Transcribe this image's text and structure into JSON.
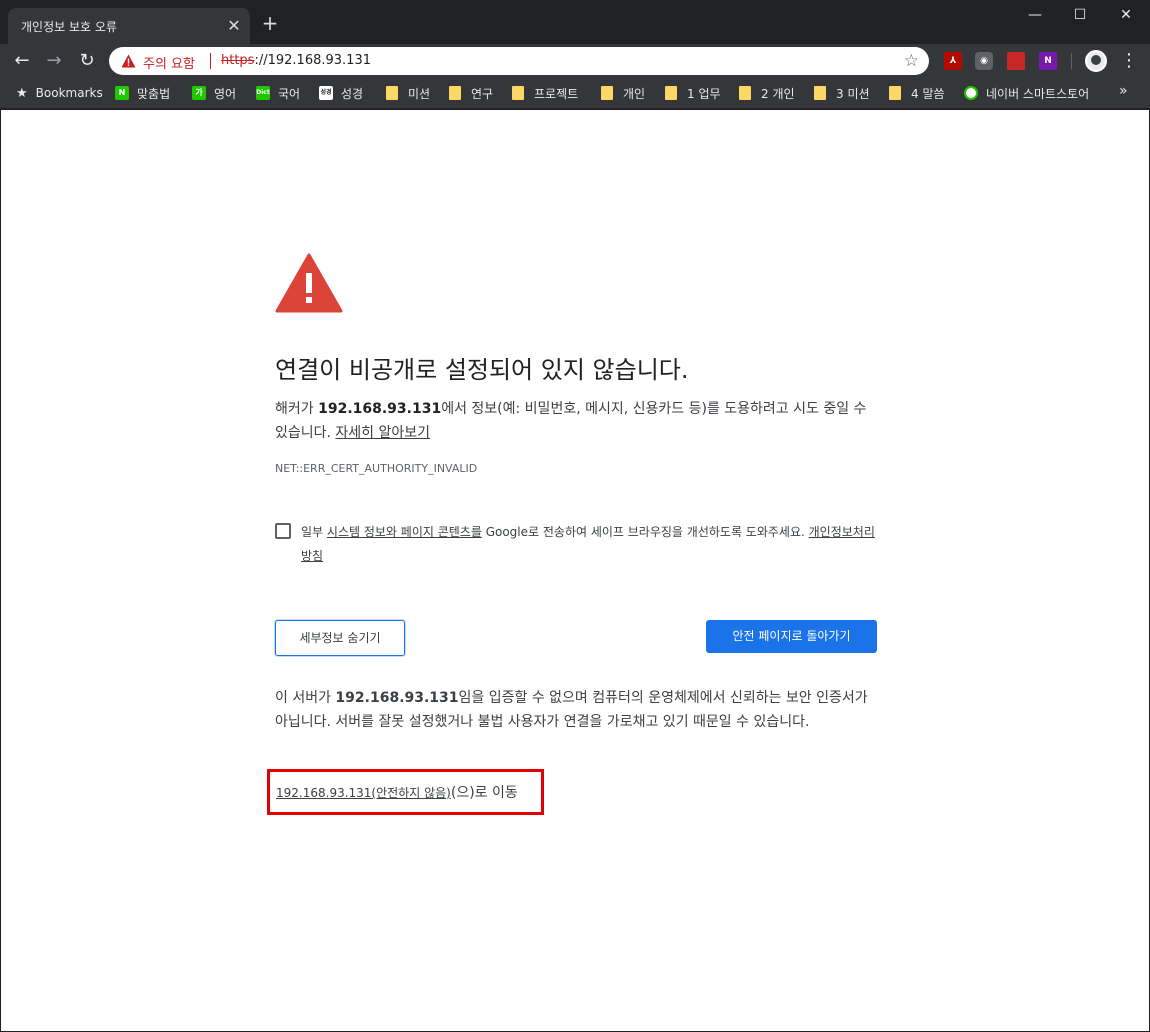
{
  "tab": {
    "title": "개인정보 보호 오류",
    "close": "✕",
    "new": "+"
  },
  "window": {
    "minimize": "—",
    "maximize": "☐",
    "close": "✕"
  },
  "toolbar": {
    "back": "←",
    "forward": "→",
    "reload": "↻",
    "security_label": "주의 요함",
    "url_scheme": "https",
    "url_host": "://192.168.93.131",
    "star": "☆",
    "menu": "⋮"
  },
  "bookmarks": {
    "items": [
      {
        "label": "Bookmarks",
        "icon": "star-icon"
      },
      {
        "label": "맞춤법",
        "icon": "naver-icon",
        "badge": "N",
        "color": "#1ec800"
      },
      {
        "label": "영어",
        "icon": "dict-icon",
        "badge": "가",
        "color": "#1ec800"
      },
      {
        "label": "국어",
        "icon": "dict-icon",
        "badge": "Dict",
        "color": "#1ec800"
      },
      {
        "label": "성경",
        "icon": "bible-icon",
        "badge": "성경",
        "color": "#ffffff"
      },
      {
        "label": "미션",
        "icon": "folder-icon"
      },
      {
        "label": "연구",
        "icon": "folder-icon"
      },
      {
        "label": "프로젝트",
        "icon": "folder-icon"
      },
      {
        "label": "개인",
        "icon": "folder-icon"
      },
      {
        "label": "1 업무",
        "icon": "folder-icon"
      },
      {
        "label": "2 개인",
        "icon": "folder-icon"
      },
      {
        "label": "3 미션",
        "icon": "folder-icon"
      },
      {
        "label": "4 말씀",
        "icon": "folder-icon"
      },
      {
        "label": "네이버 스마트스토어",
        "icon": "smartstore-icon"
      }
    ],
    "more": "»"
  },
  "page": {
    "heading": "연결이 비공개로 설정되어 있지 않습니다.",
    "intro_before": "해커가 ",
    "host": "192.168.93.131",
    "intro_after": "에서 정보(예: 비밀번호, 메시지, 신용카드 등)를 도용하려고 시도 중일 수 있습니다. ",
    "learn_more": "자세히 알아보기",
    "error_code": "NET::ERR_CERT_AUTHORITY_INVALID",
    "optin_before": "일부 ",
    "optin_link": "시스템 정보와 페이지 콘텐츠를",
    "optin_after": " Google로 전송하여 세이프 브라우징을 개선하도록 도와주세요. ",
    "privacy_link": "개인정보처리방침",
    "hide_details": "세부정보 숨기기",
    "back_to_safety": "안전 페이지로 돌아가기",
    "details_before": "이 서버가 ",
    "details_after": "임을 입증할 수 없으며 컴퓨터의 운영체제에서 신뢰하는 보안 인증서가 아닙니다. 서버를 잘못 설정했거나 불법 사용자가 연결을 가로채고 있기 때문일 수 있습니다.",
    "proceed_link": "192.168.93.131(안전하지 않음)",
    "proceed_suffix": "(으)로 이동"
  },
  "colors": {
    "accent": "#1a73e8",
    "warning": "#db4437",
    "highlight_box": "#e00000"
  }
}
